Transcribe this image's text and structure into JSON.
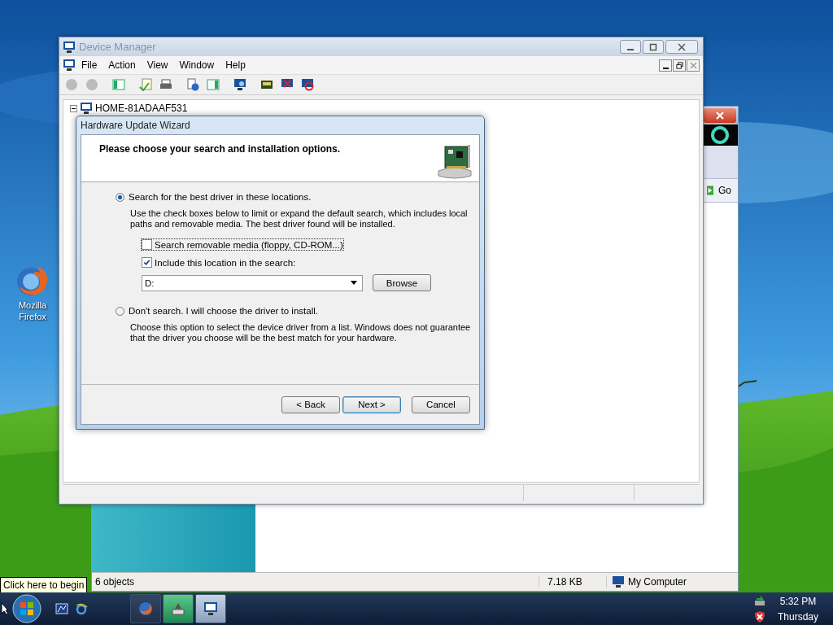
{
  "desktop": {
    "icons": [
      {
        "label": "Mozilla Firefox"
      }
    ]
  },
  "explorer_window": {
    "go_button": "Go",
    "status_bar": [
      "6 objects",
      "7.18 KB",
      "My Computer"
    ]
  },
  "device_manager": {
    "title": "Device Manager",
    "active": false,
    "menu": [
      "File",
      "Action",
      "View",
      "Window",
      "Help"
    ],
    "tree": {
      "label": "HOME-81ADAAF531",
      "expanded": true
    }
  },
  "wizard": {
    "title": "Hardware Update Wizard",
    "heading": "Please choose your search and installation options.",
    "options": [
      {
        "label": "Search for the best driver in these locations.",
        "selected": true,
        "description": "Use the check boxes below to limit or expand the default search, which includes local paths and removable media. The best driver found will be installed."
      },
      {
        "label": "Don't search. I will choose the driver to install.",
        "selected": false,
        "description": "Choose this option to select the device driver from a list.  Windows does not guarantee that the driver you choose will be the best match for your hardware."
      }
    ],
    "checkboxes": [
      {
        "label": "Search removable media (floppy, CD-ROM...)",
        "checked": false
      },
      {
        "label": "Include this location in the search:",
        "checked": true
      }
    ],
    "location": {
      "value": "D:"
    },
    "browse_button": "Browse",
    "buttons": [
      {
        "label": "< Back",
        "default": false
      },
      {
        "label": "Next >",
        "default": true
      },
      {
        "label": "Cancel",
        "default": false
      }
    ]
  },
  "tooltip": "Click here to begin",
  "taskbar": {
    "time": "5:32 PM",
    "day": "Thursday"
  }
}
